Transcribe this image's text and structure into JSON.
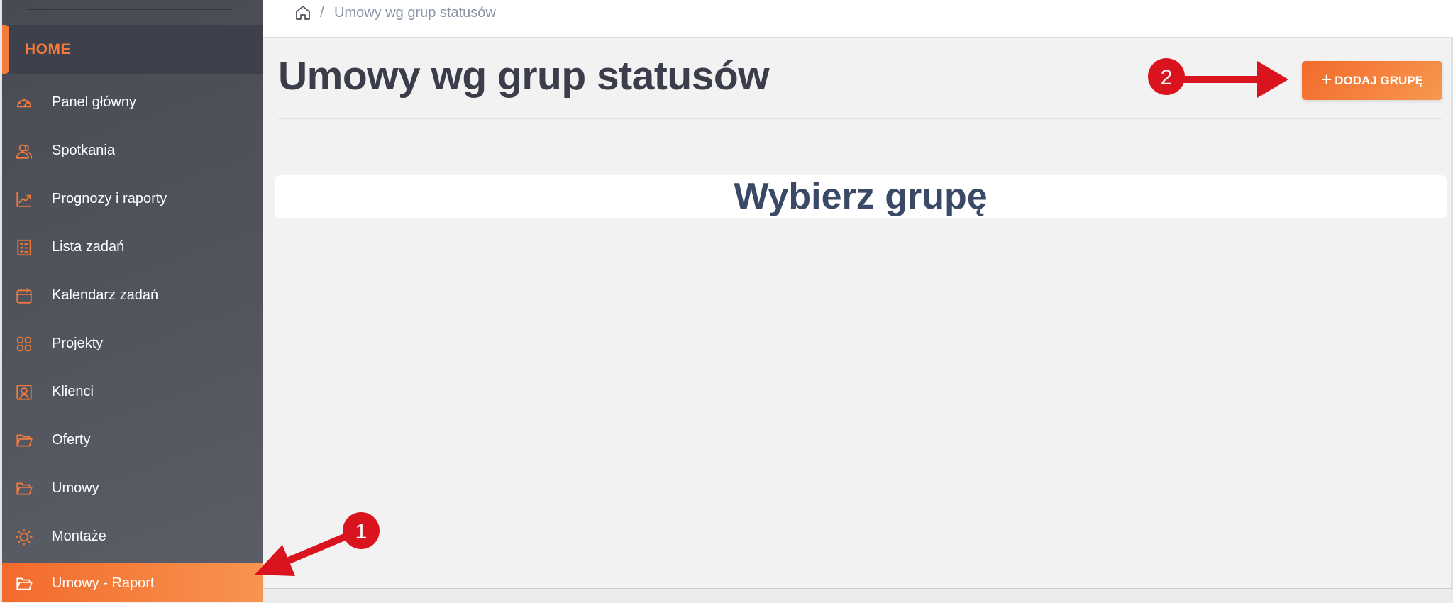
{
  "breadcrumb": {
    "home_icon": "home-icon",
    "separator": "/",
    "current": "Umowy wg grup statusów"
  },
  "sidebar": {
    "section": "HOME",
    "items": [
      {
        "label": "Panel główny",
        "icon": "speedometer-icon"
      },
      {
        "label": "Spotkania",
        "icon": "users-icon"
      },
      {
        "label": "Prognozy i raporty",
        "icon": "chart-line-icon"
      },
      {
        "label": "Lista zadań",
        "icon": "checklist-icon"
      },
      {
        "label": "Kalendarz zadań",
        "icon": "calendar-icon"
      },
      {
        "label": "Projekty",
        "icon": "grid-icon"
      },
      {
        "label": "Klienci",
        "icon": "portrait-icon"
      },
      {
        "label": "Oferty",
        "icon": "folder-open-icon"
      },
      {
        "label": "Umowy",
        "icon": "folder-icon"
      },
      {
        "label": "Montaże",
        "icon": "sun-icon"
      },
      {
        "label": "Umowy - Raport",
        "icon": "folder-open-icon",
        "active": true
      }
    ]
  },
  "page": {
    "title": "Umowy wg grup statusów",
    "add_group_label": "DODAJ GRUPĘ",
    "add_group_icon": "plus-icon",
    "placeholder_heading": "Wybierz grupę"
  },
  "annotations": [
    {
      "number": "1",
      "target": "sidebar-item-umowy-raport"
    },
    {
      "number": "2",
      "target": "add-group-button"
    }
  ],
  "colors": {
    "accent": "#f47b3a",
    "sidebar": "#52545e",
    "annotation": "#d9141f",
    "title": "#3b3d4a",
    "heading": "#3a4a66"
  }
}
